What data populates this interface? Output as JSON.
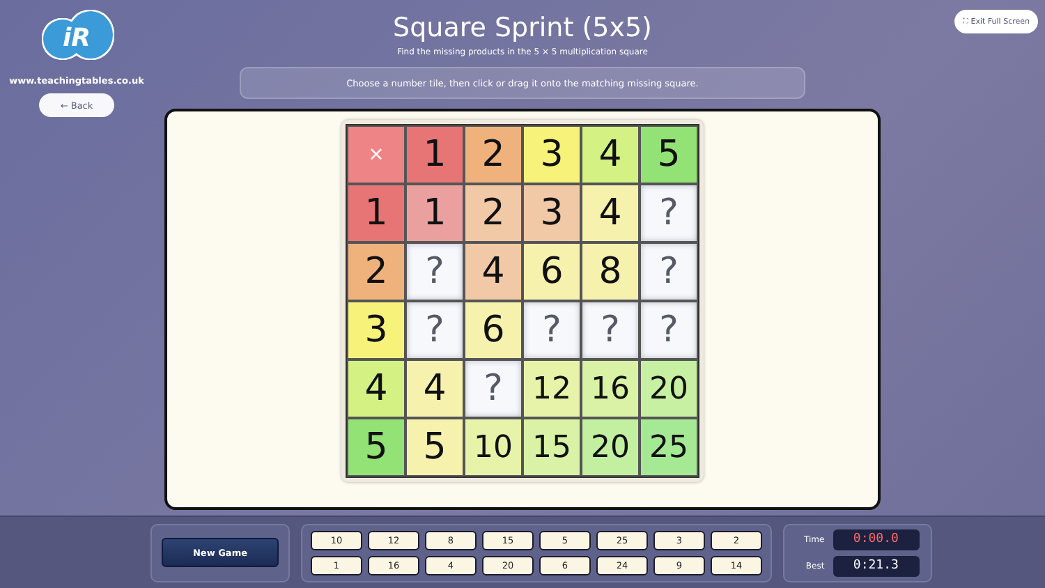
{
  "logo": {
    "text": "iR"
  },
  "site": "www.teachingtables.co.uk",
  "back_button": "← Back",
  "title": "Square Sprint (5x5)",
  "subtitle": "Find the missing products in the 5 × 5 multiplication square",
  "exit_button": {
    "icon": "⛶",
    "label": "Exit Full Screen"
  },
  "instruction": "Choose a number tile, then click or drag it onto the matching missing square.",
  "grid": [
    [
      {
        "kind": "corner",
        "text": "×",
        "color": "#ef8486"
      },
      {
        "kind": "header",
        "text": "1",
        "color": "#e77576"
      },
      {
        "kind": "header",
        "text": "2",
        "color": "#f0b27c"
      },
      {
        "kind": "header",
        "text": "3",
        "color": "#f7f27a"
      },
      {
        "kind": "header",
        "text": "4",
        "color": "#d3f283"
      },
      {
        "kind": "header",
        "text": "5",
        "color": "#93e275"
      }
    ],
    [
      {
        "kind": "header",
        "text": "1",
        "color": "#e77576"
      },
      {
        "kind": "product",
        "text": "1",
        "color": "#eba0a0"
      },
      {
        "kind": "product",
        "text": "2",
        "color": "#f2c9a6"
      },
      {
        "kind": "product",
        "text": "3",
        "color": "#f2c9a6"
      },
      {
        "kind": "product",
        "text": "4",
        "color": "#f7f1ae"
      },
      {
        "kind": "missing",
        "text": "?",
        "color": "#f6f8fb"
      }
    ],
    [
      {
        "kind": "header",
        "text": "2",
        "color": "#f0b27c"
      },
      {
        "kind": "missing",
        "text": "?",
        "color": "#f6f8fb"
      },
      {
        "kind": "product",
        "text": "4",
        "color": "#f2c9a6"
      },
      {
        "kind": "product",
        "text": "6",
        "color": "#f7f1ae"
      },
      {
        "kind": "product",
        "text": "8",
        "color": "#f7f1ae"
      },
      {
        "kind": "missing",
        "text": "?",
        "color": "#f6f8fb"
      }
    ],
    [
      {
        "kind": "header",
        "text": "3",
        "color": "#f7f27a"
      },
      {
        "kind": "missing",
        "text": "?",
        "color": "#f6f8fb"
      },
      {
        "kind": "product",
        "text": "6",
        "color": "#f7f1ae"
      },
      {
        "kind": "missing",
        "text": "?",
        "color": "#f6f8fb"
      },
      {
        "kind": "missing",
        "text": "?",
        "color": "#f6f8fb"
      },
      {
        "kind": "missing",
        "text": "?",
        "color": "#f6f8fb"
      }
    ],
    [
      {
        "kind": "header",
        "text": "4",
        "color": "#d3f283"
      },
      {
        "kind": "product",
        "text": "4",
        "color": "#f7f1ae"
      },
      {
        "kind": "missing",
        "text": "?",
        "color": "#f6f8fb"
      },
      {
        "kind": "product",
        "text": "12",
        "color": "#e6f3a8"
      },
      {
        "kind": "product",
        "text": "16",
        "color": "#d9f2a6"
      },
      {
        "kind": "product",
        "text": "20",
        "color": "#c8f0a2"
      }
    ],
    [
      {
        "kind": "header",
        "text": "5",
        "color": "#93e275"
      },
      {
        "kind": "product",
        "text": "5",
        "color": "#f7f1ae"
      },
      {
        "kind": "product",
        "text": "10",
        "color": "#e6f3a8"
      },
      {
        "kind": "product",
        "text": "15",
        "color": "#d9f2a6"
      },
      {
        "kind": "product",
        "text": "20",
        "color": "#c2efa0"
      },
      {
        "kind": "product",
        "text": "25",
        "color": "#a6e995"
      }
    ]
  ],
  "new_game_button": "New Game",
  "tiles": [
    "10",
    "12",
    "8",
    "15",
    "5",
    "25",
    "3",
    "2",
    "1",
    "16",
    "4",
    "20",
    "6",
    "24",
    "9",
    "14"
  ],
  "timer": {
    "time_label": "Time",
    "time": "0:00.0",
    "best_label": "Best",
    "best": "0:21.3"
  }
}
